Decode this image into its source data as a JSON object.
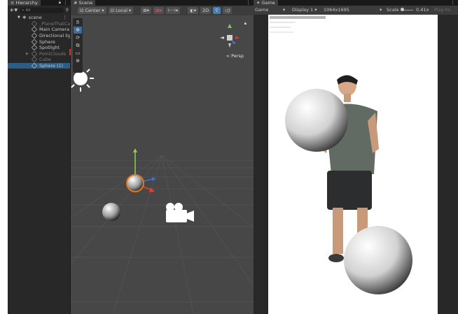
{
  "hierarchy": {
    "tab_label": "Hierarchy",
    "search_placeholder": "All",
    "scene_name": "scene",
    "items": [
      {
        "label": "_PlaneThatCalls",
        "dim": true
      },
      {
        "label": "Main Camera",
        "dim": false
      },
      {
        "label": "Directional light",
        "dim": false
      },
      {
        "label": "Sphere",
        "dim": false
      },
      {
        "label": "Spotlight",
        "dim": false
      },
      {
        "label": "PointClouds",
        "dim": true
      },
      {
        "label": "Cube",
        "dim": true
      },
      {
        "label": "Sphere (1)",
        "dim": false,
        "selected": true
      }
    ]
  },
  "scene": {
    "tab_label": "Scene",
    "pivot_label": "Center",
    "space_label": "Local",
    "mode_2d": "2D",
    "persp_label": "< Persp",
    "tools": [
      "hand",
      "move",
      "rotate",
      "scale",
      "rect",
      "transform"
    ]
  },
  "game": {
    "tab_label": "Game",
    "view_label": "Game",
    "display_label": "Display 1",
    "resolution_label": "1064x1695",
    "scale_label": "Scale",
    "scale_value": "0.41x",
    "play_label": "Play Fo"
  },
  "colors": {
    "panel_bg": "#282828",
    "scene_bg": "#474747",
    "selection": "#2c5d87",
    "accent_blue": "#4a7ab0"
  }
}
